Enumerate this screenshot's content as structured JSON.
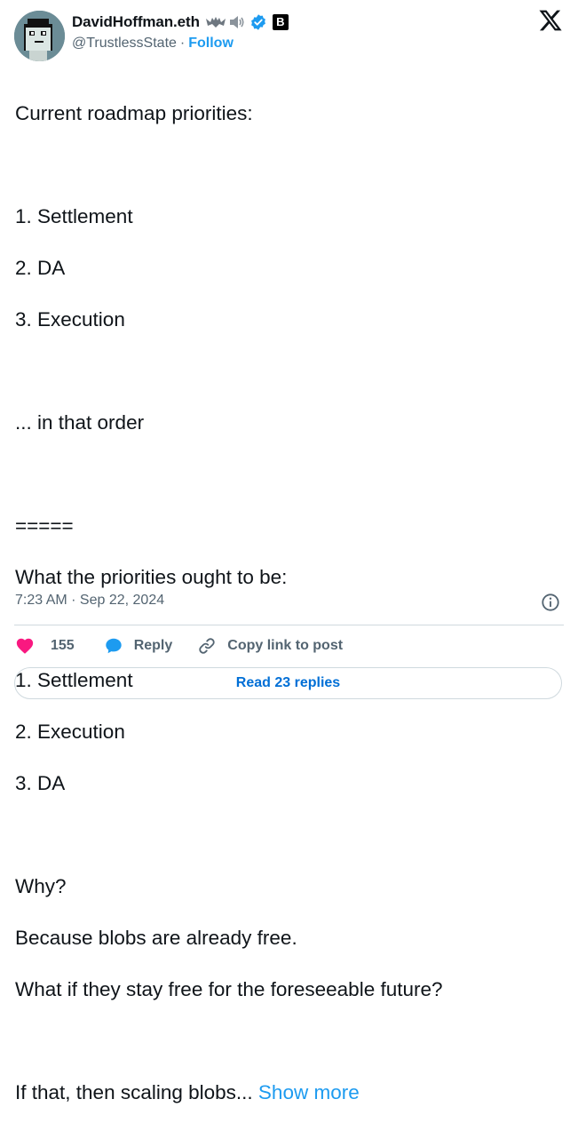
{
  "author": {
    "display_name": "DavidHoffman.eth",
    "handle": "@TrustlessState",
    "separator": "·",
    "follow_label": "Follow",
    "affiliate_badge": "B"
  },
  "tweet": {
    "lines": [
      "Current roadmap priorities:",
      "",
      "1. Settlement",
      "2. DA",
      "3. Execution",
      "",
      "... in that order",
      "",
      "=====",
      "What the priorities ought to be:",
      "",
      "1. Settlement",
      "2. Execution",
      "3. DA",
      "",
      "Why?",
      "Because blobs are already free.",
      "What if they stay free for the foreseeable future?",
      ""
    ],
    "last_line_text": "If that, then scaling blobs... ",
    "show_more_label": "Show more",
    "timestamp": "7:23 AM · Sep 22, 2024"
  },
  "actions": {
    "like_count": "155",
    "reply_label": "Reply",
    "copy_link_label": "Copy link to post"
  },
  "footer": {
    "read_replies_label": "Read 23 replies"
  },
  "icons": {
    "avatar": "punk-avatar",
    "emoji": [
      "bat-icon",
      "speaker-icon"
    ],
    "verified": "verified-badge-icon",
    "brand": "x-logo-icon",
    "info": "info-icon",
    "like": "heart-icon",
    "reply": "speech-bubble-icon",
    "copy": "link-icon"
  },
  "colors": {
    "text": "#0f1419",
    "secondary": "#536471",
    "accent": "#1d9bf0",
    "like": "#f91880",
    "border": "#cfd9de",
    "replies_link": "#006fd6"
  }
}
